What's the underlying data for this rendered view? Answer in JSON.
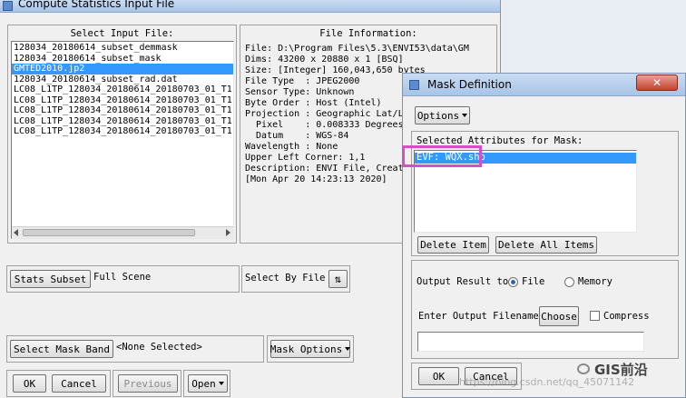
{
  "main_window": {
    "title": "Compute Statistics Input File",
    "select_input_label": "Select Input File:",
    "files": [
      "128034_20180614_subset_demmask",
      "128034_20180614_subset_mask",
      "GMTED2010.jp2",
      "128034_20180614_subset_rad.dat",
      "LC08_L1TP_128034_20180614_20180703_01_T1",
      "LC08_L1TP_128034_20180614_20180703_01_T1",
      "LC08_L1TP_128034_20180614_20180703_01_T1",
      "LC08_L1TP_128034_20180614_20180703_01_T1",
      "LC08_L1TP_128034_20180614_20180703_01_T1"
    ],
    "selected_file_index": 2,
    "file_info_label": "File Information:",
    "file_info": [
      "File: D:\\Program Files\\5.3\\ENVI53\\data\\GM",
      "Dims: 43200 x 20880 x 1 [BSQ]",
      "Size: [Integer] 160,043,650 bytes",
      "File Type  : JPEG2000",
      "Sensor Type: Unknown",
      "Byte Order : Host (Intel)",
      "Projection : Geographic Lat/L",
      "  Pixel    : 0.008333 Degrees",
      "  Datum    : WGS-84",
      "Wavelength : None",
      "Upper Left Corner: 1,1",
      "Description: ENVI File, Creat",
      "[Mon Apr 20 14:23:13 2020]"
    ],
    "stats_subset_button": "Stats Subset",
    "full_scene": "Full Scene",
    "select_by_file": "Select By File",
    "select_mask_band_button": "Select Mask Band",
    "none_selected": "<None Selected>",
    "mask_options_button": "Mask Options",
    "ok_button": "OK",
    "cancel_button": "Cancel",
    "previous_button": "Previous",
    "open_button": "Open"
  },
  "mask_dialog": {
    "title": "Mask Definition",
    "options_button": "Options",
    "selected_attributes_label": "Selected Attributes for Mask:",
    "attributes": [
      "EVF: WQX.shp"
    ],
    "delete_item_button": "Delete Item",
    "delete_all_button": "Delete All Items",
    "output_result_label": "Output Result to",
    "output_file_option": "File",
    "output_memory_option": "Memory",
    "output_selected": "File",
    "filename_label": "Enter Output Filename",
    "choose_button": "Choose",
    "compress_label": "Compress",
    "compress_checked": false,
    "filename_value": "",
    "ok_button": "OK",
    "cancel_button": "Cancel",
    "highlight_color": "#d44fc8"
  },
  "watermark": {
    "brand": "GIS前沿",
    "url": "https://blog.csdn.net/qq_45071142"
  }
}
